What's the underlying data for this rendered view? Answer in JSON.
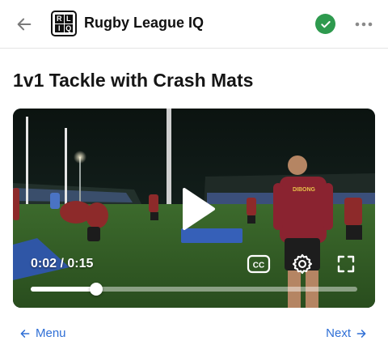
{
  "header": {
    "app_title": "Rugby League IQ",
    "logo_letters": [
      "R",
      "L",
      "I",
      "Q"
    ],
    "verified_color": "#2e9a4e",
    "back_icon": "arrow-left-icon",
    "more_icon": "more-horizontal-icon"
  },
  "page": {
    "title": "1v1 Tackle with Crash Mats"
  },
  "video": {
    "current_time": "0:02",
    "duration": "0:15",
    "time_display": "0:02 / 0:15",
    "progress_fraction": 0.2,
    "shirt_print": "DIBONG",
    "controls": [
      "play-icon",
      "closed-captions-icon",
      "settings-gear-icon",
      "fullscreen-icon"
    ]
  },
  "nav": {
    "prev_label": "Menu",
    "next_label": "Next",
    "link_color": "#2f6fd6"
  }
}
